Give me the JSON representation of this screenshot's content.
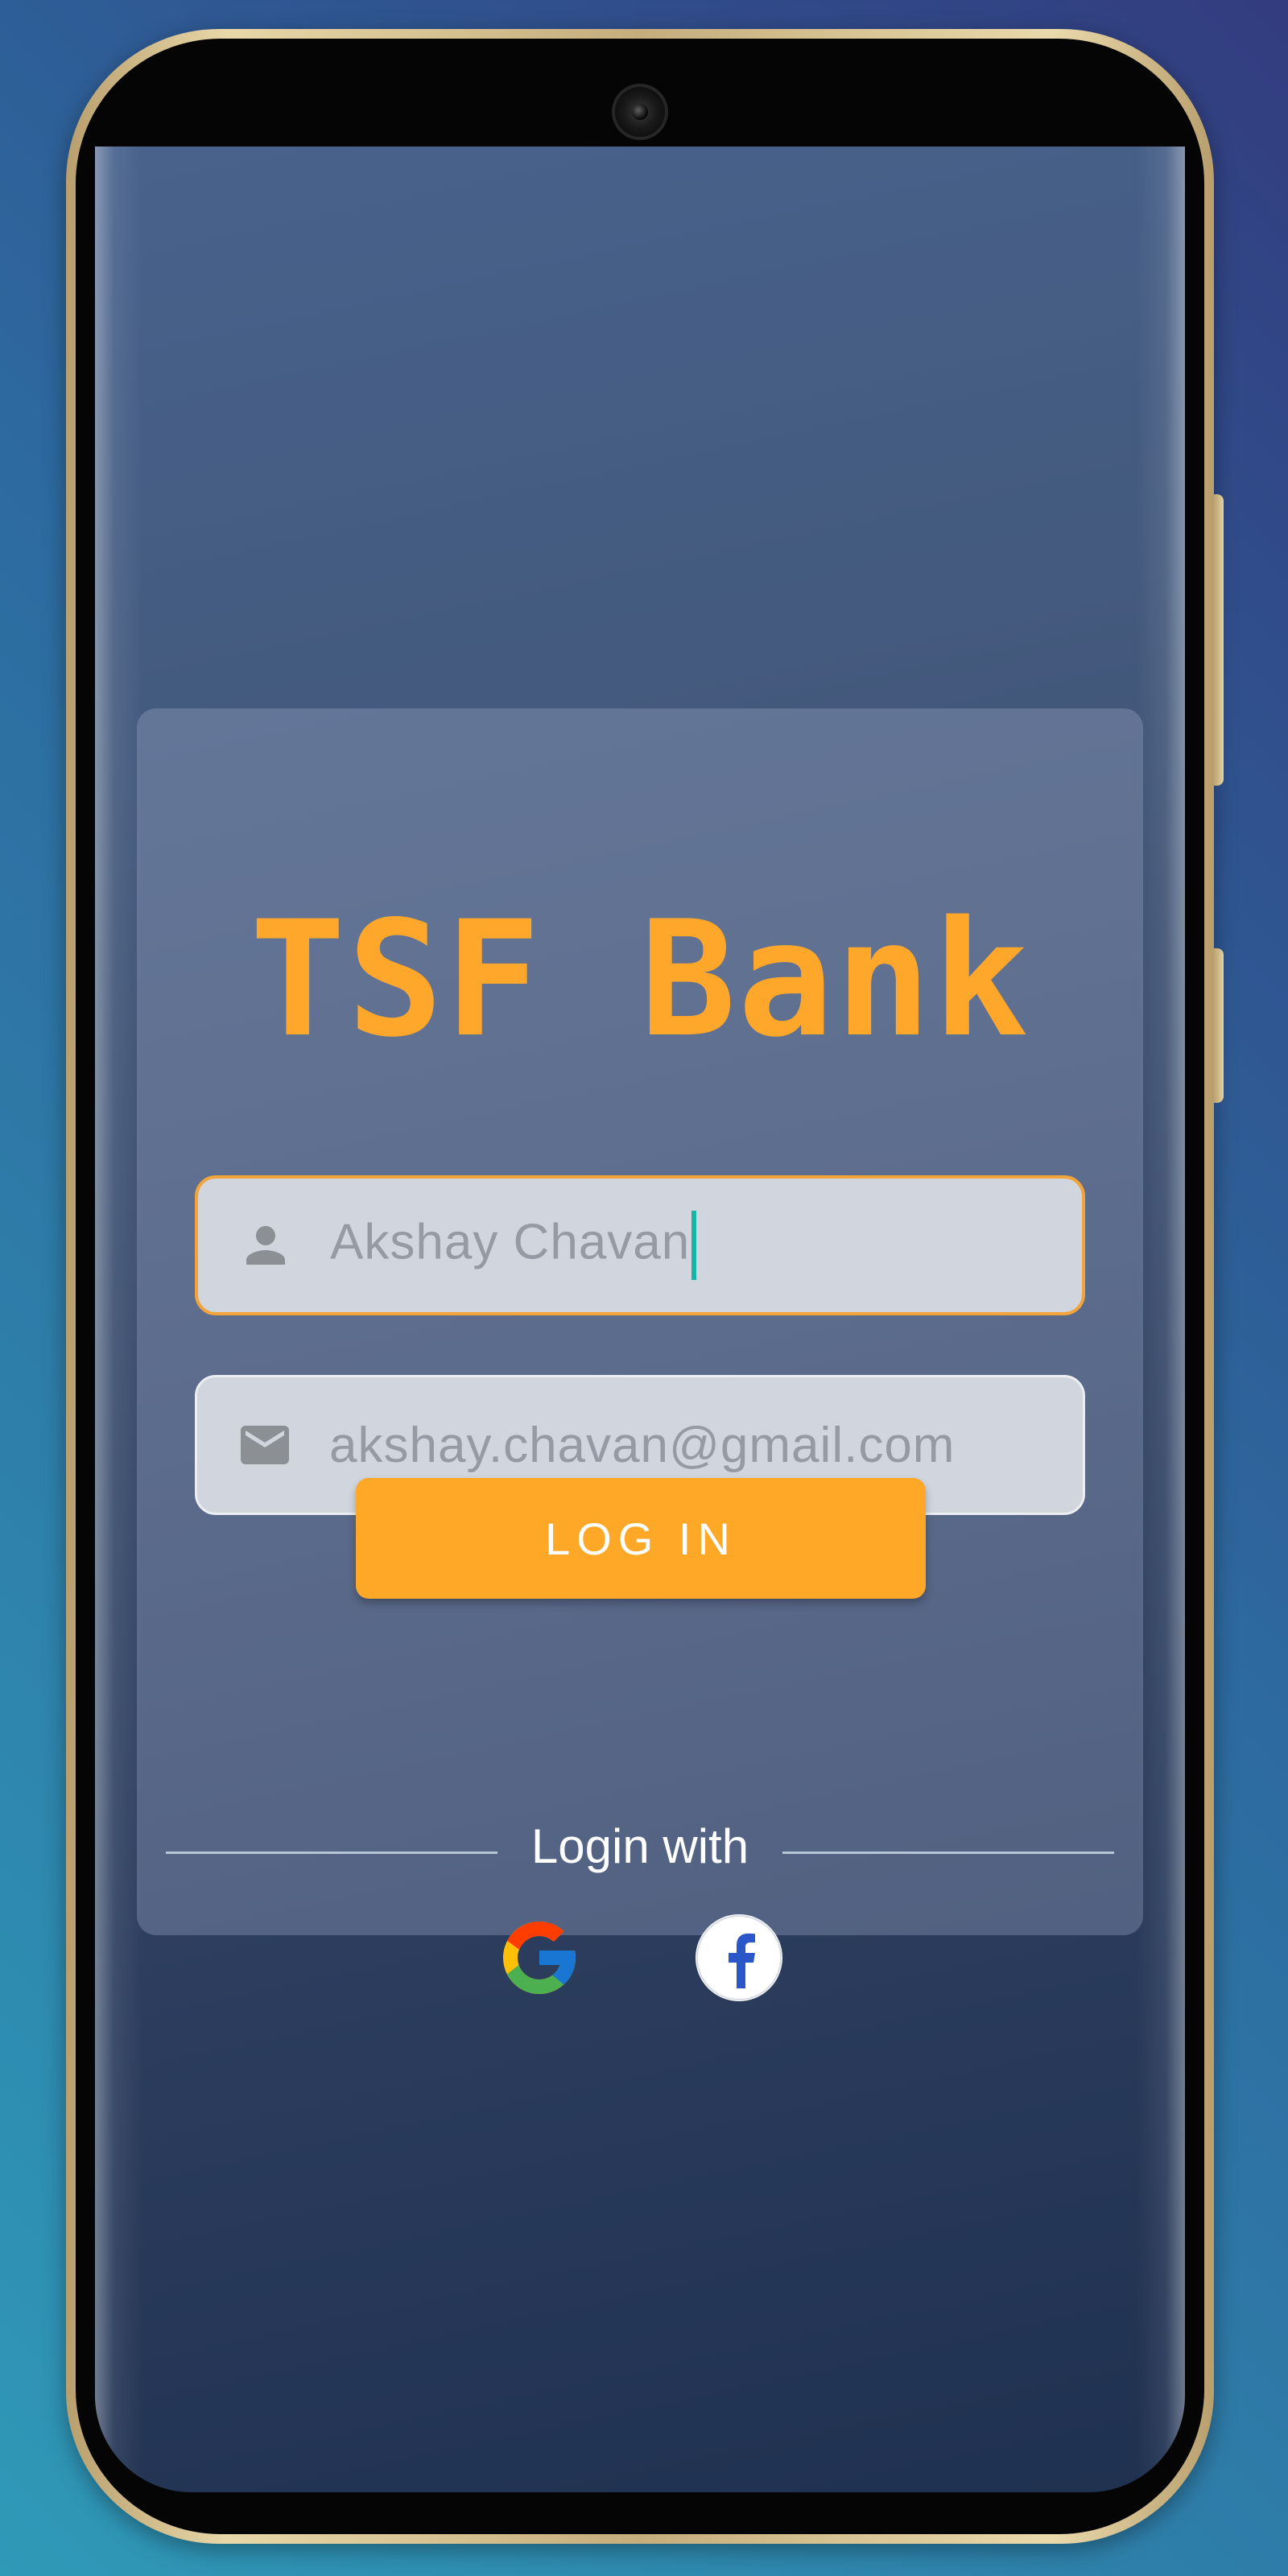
{
  "app": {
    "title": "TSF Bank"
  },
  "form": {
    "name_field": {
      "value": "Akshay Chavan",
      "icon": "person-icon"
    },
    "email_field": {
      "value": "akshay.chavan@gmail.com",
      "icon": "mail-icon"
    },
    "login_button_label": "LOG IN",
    "login_with_label": "Login with"
  },
  "social": {
    "google_icon": "google-icon",
    "facebook_icon": "facebook-icon"
  },
  "colors": {
    "accent": "#ffa726",
    "title": "#ffa72a",
    "caret": "#14b5a8",
    "field_background": "#d0d5de",
    "focused_border": "#f2a33a"
  }
}
